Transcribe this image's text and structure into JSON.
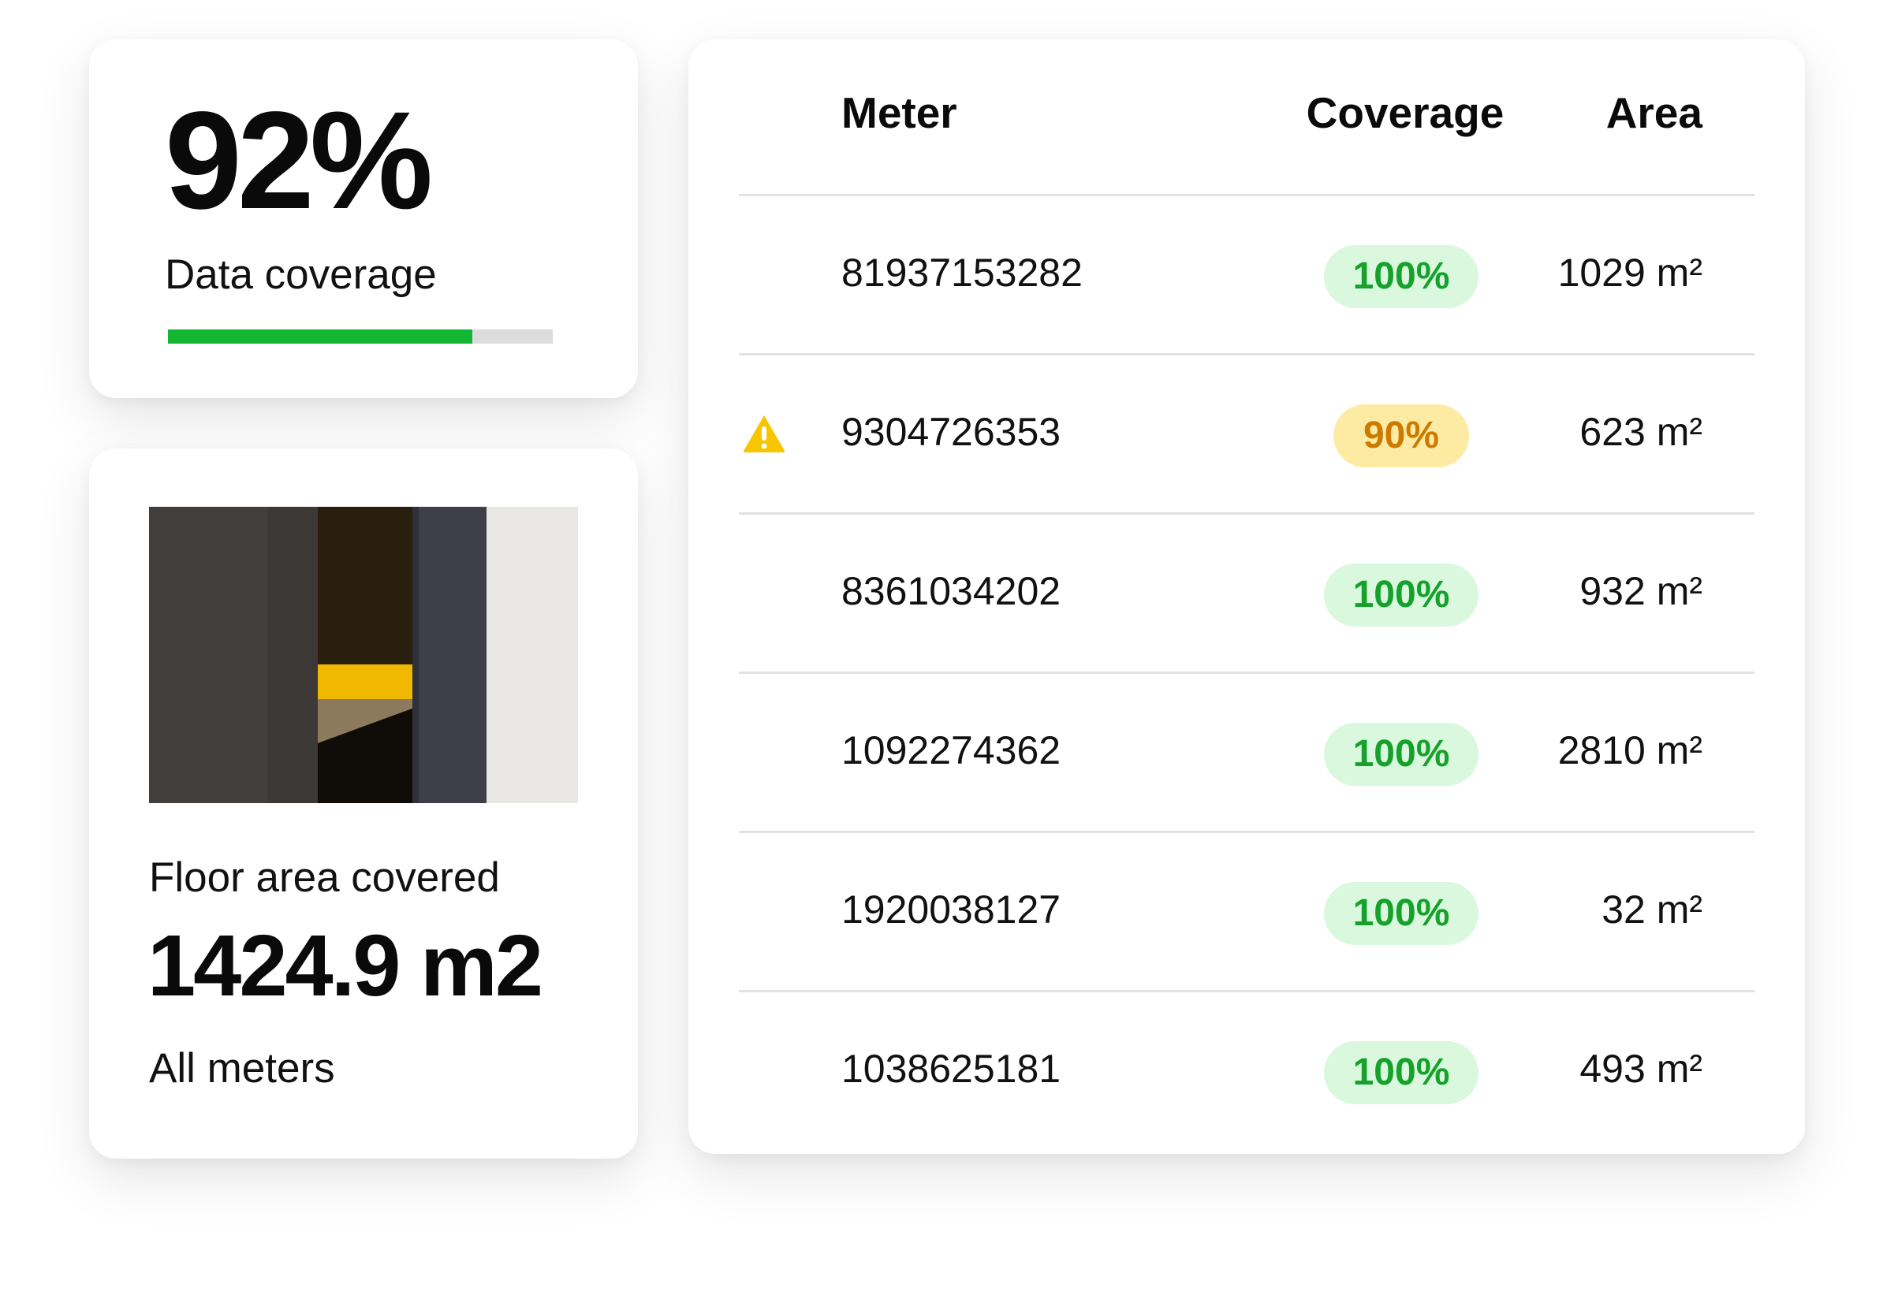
{
  "summary": {
    "coverage_value": "92%",
    "coverage_label": "Data coverage",
    "coverage_progress": 0.79,
    "coverage_fill_color": "#12b633",
    "floor_label": "Floor area covered",
    "floor_value": "1424.9 m2",
    "floor_sub": "All meters"
  },
  "table": {
    "headers": {
      "meter": "Meter",
      "coverage": "Coverage",
      "area": "Area"
    },
    "rows": [
      {
        "meter": "81937153282",
        "coverage": "100%",
        "area": "1029 m²",
        "status": "ok",
        "warning": false
      },
      {
        "meter": "9304726353",
        "coverage": "90%",
        "area": "623 m²",
        "status": "warning",
        "warning": true
      },
      {
        "meter": "8361034202",
        "coverage": "100%",
        "area": "932 m²",
        "status": "ok",
        "warning": false
      },
      {
        "meter": "1092274362",
        "coverage": "100%",
        "area": "2810 m²",
        "status": "ok",
        "warning": false
      },
      {
        "meter": "1920038127",
        "coverage": "100%",
        "area": "32 m²",
        "status": "ok",
        "warning": false
      },
      {
        "meter": "1038625181",
        "coverage": "100%",
        "area": "493 m²",
        "status": "ok",
        "warning": false
      }
    ],
    "warning_icon": "warning-triangle-icon",
    "colors": {
      "ok_bg": "#d9f8dd",
      "ok_text": "#15a12b",
      "warn_bg": "#fdeba4",
      "warn_text": "#cc7a00",
      "warn_icon": "#f7c600"
    }
  }
}
